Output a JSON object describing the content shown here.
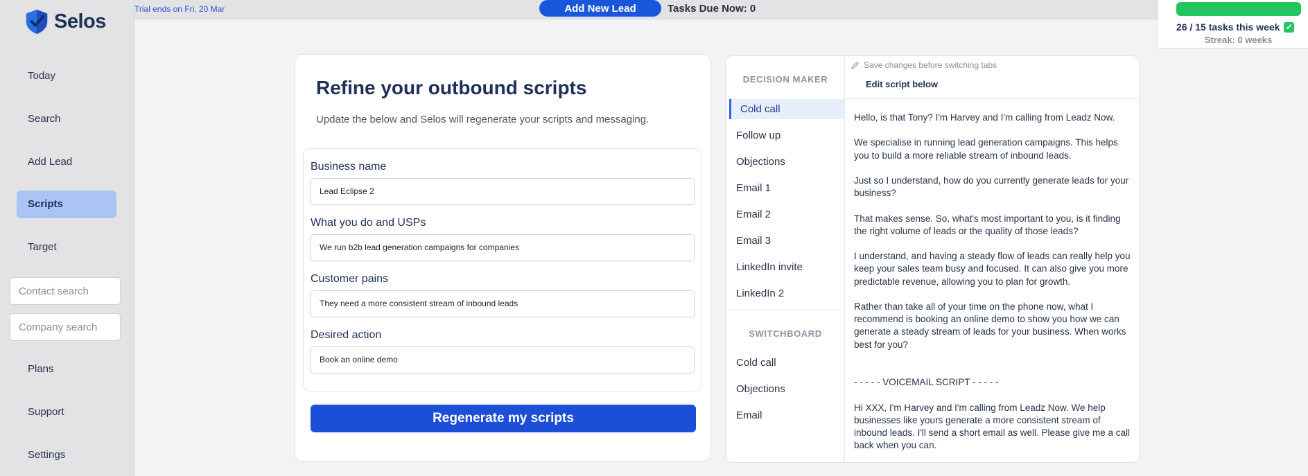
{
  "app": {
    "name": "Selos"
  },
  "sidebar": {
    "items": [
      {
        "label": "Today"
      },
      {
        "label": "Search"
      },
      {
        "label": "Add Lead"
      },
      {
        "label": "Scripts"
      },
      {
        "label": "Target"
      },
      {
        "label": "Plans"
      },
      {
        "label": "Support"
      },
      {
        "label": "Settings"
      }
    ],
    "active_item": "Scripts",
    "contact_search_placeholder": "Contact search",
    "company_search_placeholder": "Company search"
  },
  "topbar": {
    "trial_text": "Trial ends on Fri, 20 Mar",
    "add_lead_label": "Add New Lead",
    "tasks_due": "Tasks Due Now: 0"
  },
  "progress": {
    "text": "26 / 15  tasks this week",
    "fill_fraction": 1.0,
    "streak": "Streak: 0 weeks"
  },
  "refine": {
    "title": "Refine your outbound scripts",
    "subtitle": "Update the below and Selos will regenerate your scripts and messaging.",
    "fields": [
      {
        "label": "Business name",
        "value": "Lead Eclipse 2"
      },
      {
        "label": "What you do and USPs",
        "value": "We run b2b lead generation campaigns for companies"
      },
      {
        "label": "Customer pains",
        "value": "They need a more consistent stream of inbound leads"
      },
      {
        "label": "Desired action",
        "value": "Book an online demo"
      }
    ],
    "button_label": "Regenerate my scripts"
  },
  "scripts": {
    "decision_maker_heading": "DECISION MAKER",
    "decision_maker_tabs": [
      "Cold call",
      "Follow up",
      "Objections",
      "Email 1",
      "Email 2",
      "Email 3",
      "LinkedIn invite",
      "LinkedIn 2"
    ],
    "switchboard_heading": "SWITCHBOARD",
    "switchboard_tabs": [
      "Cold call",
      "Objections",
      "Email"
    ],
    "active_tab": "Cold call",
    "save_note": "Save changes before switching tabs",
    "edit_label": "Edit script below",
    "script_text": "Hello, is that Tony? I'm Harvey and I'm calling from Leadz Now.\n\nWe specialise in running lead generation campaigns. This helps you to build a more reliable stream of inbound leads.\n\nJust so I understand, how do you currently generate leads for your business?\n\nThat makes sense. So, what's most important to you, is it finding the right volume of leads or the quality of those leads?\n\nI understand, and having a steady flow of leads can really help you keep your sales team busy and focused. It can also give you more predictable revenue, allowing you to plan for growth.\n\nRather than take all of your time on the phone now, what I recommend is booking an online demo to show you how we can generate a steady stream of leads for your business. When works best for you?\n\n\n- - - - - VOICEMAIL SCRIPT - - - - -\n\nHi XXX, I'm Harvey and I'm calling from Leadz Now. We help businesses like yours generate a more consistent stream of inbound leads. I'll send a short email as well. Please give me a call back when you can."
  },
  "colors": {
    "brand_navy": "#1e2f58",
    "primary_blue": "#1d4ed8",
    "sidebar_active": "#a9c4f5",
    "success_green": "#22c55e"
  }
}
